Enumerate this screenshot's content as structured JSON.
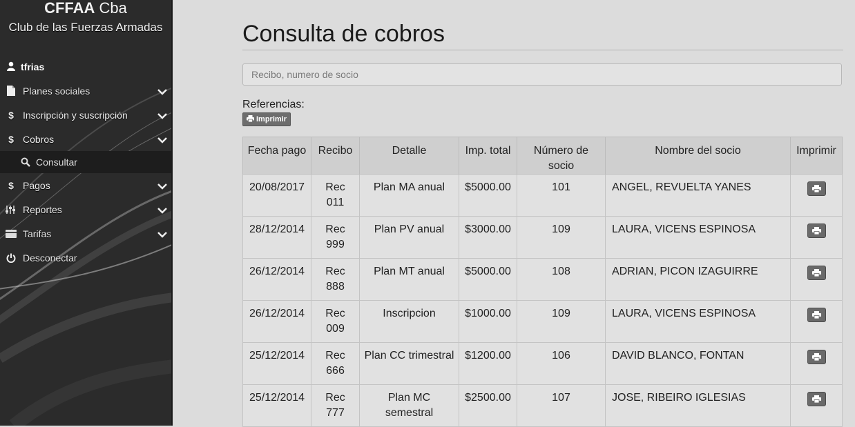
{
  "brand": {
    "title_bold": "CFFAA",
    "title_rest": " Cba",
    "subtitle": "Club de las Fuerzas Armadas"
  },
  "user": {
    "name": "tfrias"
  },
  "nav": {
    "items": [
      {
        "label": "Planes sociales",
        "icon": "document-icon"
      },
      {
        "label": "Inscripción y suscripción",
        "icon": "dollar-icon"
      },
      {
        "label": "Cobros",
        "icon": "dollar-icon"
      },
      {
        "label": "Pagos",
        "icon": "dollar-icon"
      },
      {
        "label": "Reportes",
        "icon": "sliders-icon"
      },
      {
        "label": "Tarifas",
        "icon": "card-icon"
      },
      {
        "label": "Desconectar",
        "icon": "power-icon"
      }
    ],
    "sub_consultar": "Consultar"
  },
  "page": {
    "title": "Consulta de cobros",
    "search_placeholder": "Recibo, numero de socio",
    "refs_label": "Referencias:",
    "print_label": "Imprimir"
  },
  "table": {
    "headers": [
      "Fecha pago",
      "Recibo",
      "Detalle",
      "Imp. total",
      "Número de socio",
      "Nombre del socio",
      "Imprimir"
    ],
    "rows": [
      [
        "20/08/2017",
        "Rec 011",
        "Plan MA anual",
        "$5000.00",
        "101",
        "ANGEL, REVUELTA YANES"
      ],
      [
        "28/12/2014",
        "Rec 999",
        "Plan PV anual",
        "$3000.00",
        "109",
        "LAURA, VICENS ESPINOSA"
      ],
      [
        "26/12/2014",
        "Rec 888",
        "Plan MT anual",
        "$5000.00",
        "108",
        "ADRIAN, PICON IZAGUIRRE"
      ],
      [
        "26/12/2014",
        "Rec 009",
        "Inscripcion",
        "$1000.00",
        "109",
        "LAURA, VICENS ESPINOSA"
      ],
      [
        "25/12/2014",
        "Rec 666",
        "Plan CC trimestral",
        "$1200.00",
        "106",
        "DAVID BLANCO, FONTAN"
      ],
      [
        "25/12/2014",
        "Rec 777",
        "Plan MC semestral",
        "$2500.00",
        "107",
        "JOSE, RIBEIRO IGLESIAS"
      ]
    ]
  }
}
